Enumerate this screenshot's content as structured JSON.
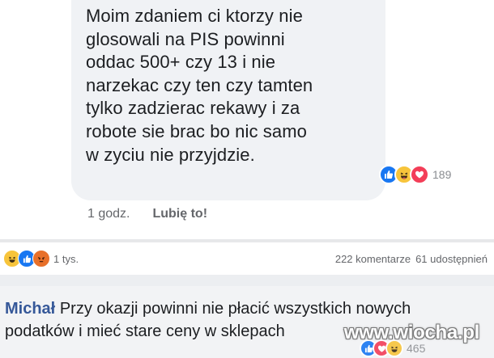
{
  "top_comment": {
    "lines": [
      "Moim zdaniem ci ktorzy nie",
      "glosowali na PIS powinni",
      "oddac 500+ czy 13 i nie",
      "narzekac czy ten czy tamten",
      "tylko zadzierac rekawy i za",
      "robote sie brac bo nic samo",
      "w zyciu nie przyjdzie."
    ],
    "reactions": [
      "like",
      "haha",
      "love"
    ],
    "reaction_count": "189",
    "time": "1 godz.",
    "like_label": "Lubię to!"
  },
  "post_stats": {
    "reactions": [
      "haha",
      "like",
      "angry"
    ],
    "reaction_count": "1 tys.",
    "comments": "222 komentarze",
    "shares": "61 udostępnień"
  },
  "bottom_comment": {
    "author": "Michał",
    "line1": "Przy okazji powinni nie płacić wszystkich nowych",
    "line2": "podatków i mieć stare ceny w sklepach",
    "reactions": [
      "like",
      "love",
      "haha"
    ],
    "reaction_count": "465"
  },
  "watermark": "www.wiocha.pl",
  "colors": {
    "like": "#1877f2",
    "haha": "#f7c43b",
    "love": "#f33e58",
    "angry": "#e8702a",
    "author": "#365899",
    "bubble": "#f0f2f5"
  }
}
